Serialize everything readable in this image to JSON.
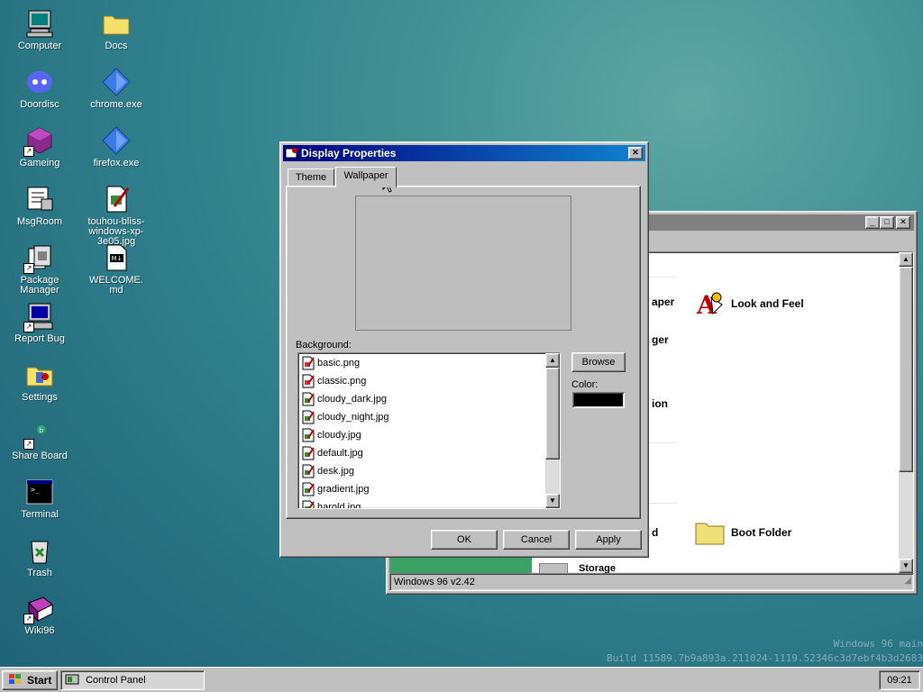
{
  "desktop": {
    "icons": [
      {
        "label": "Computer"
      },
      {
        "label": "Docs"
      },
      {
        "label": "Doordisc"
      },
      {
        "label": "chrome.exe"
      },
      {
        "label": "Gameing"
      },
      {
        "label": "firefox.exe"
      },
      {
        "label": "MsgRoom"
      },
      {
        "label": "touhou-bliss-windows-xp-3e05.jpg"
      },
      {
        "label": "Package Manager"
      },
      {
        "label": "WELCOME.md"
      },
      {
        "label": "Report Bug"
      },
      {
        "label": "Settings"
      },
      {
        "label": "Share Board"
      },
      {
        "label": "Terminal"
      },
      {
        "label": "Trash"
      },
      {
        "label": "Wiki96"
      }
    ],
    "watermark": {
      "line1": "Windows 96 main",
      "line2": "Build 11589.7b9a893a.211024-1119.52346c3d7ebf4b3d2683"
    }
  },
  "control_panel": {
    "status_text": "Windows 96 v2.42",
    "items": [
      {
        "label": "aper"
      },
      {
        "label": "Look and Feel"
      },
      {
        "label": "ger"
      },
      {
        "label": "ion"
      },
      {
        "label": "d"
      },
      {
        "label": "Boot Folder"
      },
      {
        "label": "Storage"
      }
    ]
  },
  "dialog": {
    "title": "Display Properties",
    "close_glyph": "✕",
    "tabs": [
      "Theme",
      "Wallpaper"
    ],
    "active_tab": "Wallpaper",
    "background_label": "Background:",
    "files": [
      "basic.png",
      "classic.png",
      "cloudy_dark.jpg",
      "cloudy_night.jpg",
      "cloudy.jpg",
      "default.jpg",
      "desk.jpg",
      "gradient.jpg",
      "harold.jpg"
    ],
    "browse_label": "Browse",
    "color_label": "Color:",
    "color_value": "#000000",
    "ok_label": "OK",
    "cancel_label": "Cancel",
    "apply_label": "Apply"
  },
  "taskbar": {
    "start_label": "Start",
    "task_label": "Control Panel",
    "clock": "09:21"
  }
}
